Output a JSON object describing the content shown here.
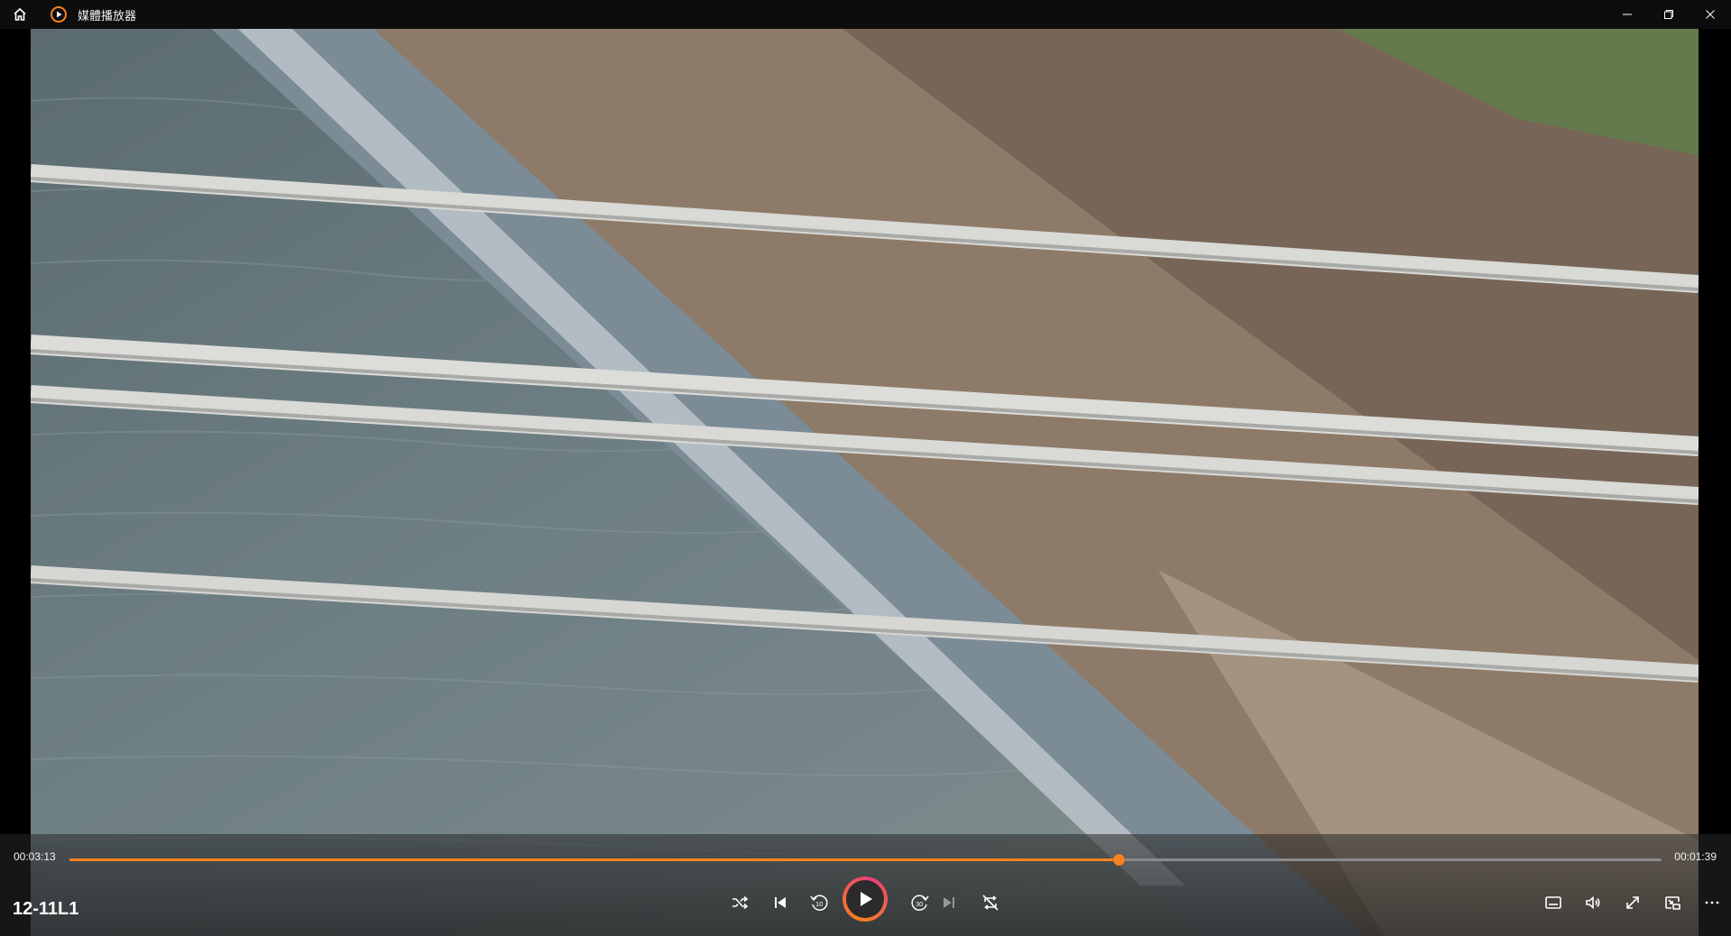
{
  "app": {
    "title": "媒體播放器",
    "icons": {
      "home": "home-icon",
      "logo": "media-player-logo-icon",
      "minimize": "minimize-icon",
      "restore": "restore-icon",
      "close": "close-icon"
    }
  },
  "player": {
    "media_title": "12-11L1",
    "time_elapsed": "00:03:13",
    "time_remaining": "00:01:39",
    "progress_fraction": 0.659,
    "accent_color": "#f7821e",
    "controls": {
      "left_group": [
        "shuffle-icon",
        "previous-icon",
        "rewind-10-icon",
        "play-icon",
        "forward-30-icon",
        "next-icon",
        "repeat-off-icon"
      ],
      "right_group": [
        "subtitles-icon",
        "volume-icon",
        "fullscreen-icon",
        "mini-view-icon",
        "more-options-icon"
      ],
      "rewind_label": "10",
      "forward_label": "30"
    }
  }
}
